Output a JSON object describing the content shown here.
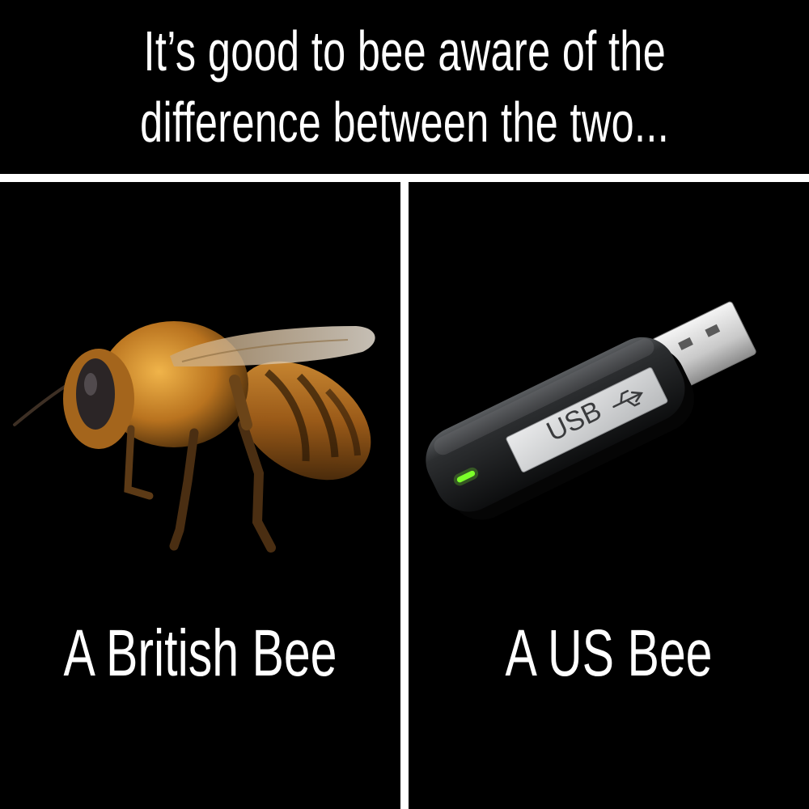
{
  "header": {
    "line1": "It’s good to bee aware of the",
    "line2": "difference between the two..."
  },
  "left_panel": {
    "image_icon": "honeybee",
    "caption": "A British Bee"
  },
  "right_panel": {
    "image_icon": "usb-flash-drive",
    "device_label": "USB",
    "caption": "A US Bee"
  },
  "colors": {
    "background": "#000000",
    "text": "#ffffff",
    "divider": "#ffffff",
    "led": "#7cff2a"
  }
}
